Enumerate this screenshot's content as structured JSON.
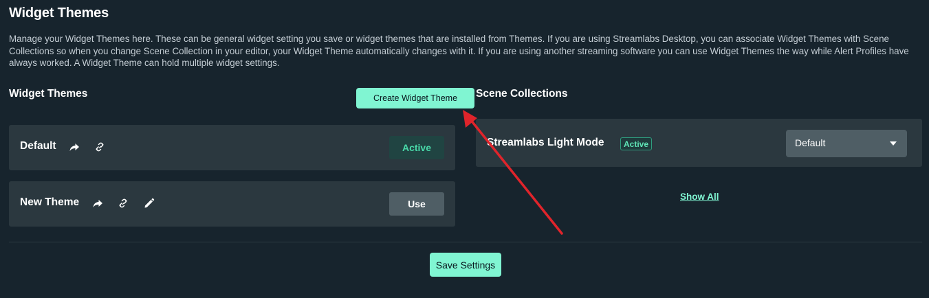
{
  "page": {
    "title": "Widget Themes",
    "description": "Manage your Widget Themes here. These can be general widget setting you save or widget themes that are installed from Themes. If you are using Streamlabs Desktop, you can associate Widget Themes with Scene Collections so when you change Scene Collection in your editor, your Widget Theme automatically changes with it. If you are using another streaming software you can use Widget Themes the way while Alert Profiles have always worked. A Widget Theme can hold multiple widget settings."
  },
  "themes": {
    "title": "Widget Themes",
    "create_label": "Create Widget Theme",
    "items": [
      {
        "name": "Default",
        "status_label": "Active",
        "icons": [
          "share-icon",
          "link-icon"
        ]
      },
      {
        "name": "New Theme",
        "status_label": "Use",
        "icons": [
          "share-icon",
          "link-icon",
          "edit-icon"
        ]
      }
    ]
  },
  "scenes": {
    "title": "Scene Collections",
    "items": [
      {
        "name": "Streamlabs Light Mode",
        "badge": "Active",
        "selected_theme": "Default"
      }
    ],
    "show_all_label": "Show All"
  },
  "footer": {
    "save_label": "Save Settings"
  },
  "colors": {
    "background": "#17242d",
    "card": "#2b383f",
    "accent": "#80f5d2",
    "active_text": "#49d9a9",
    "annotation_arrow": "#e0242b"
  }
}
